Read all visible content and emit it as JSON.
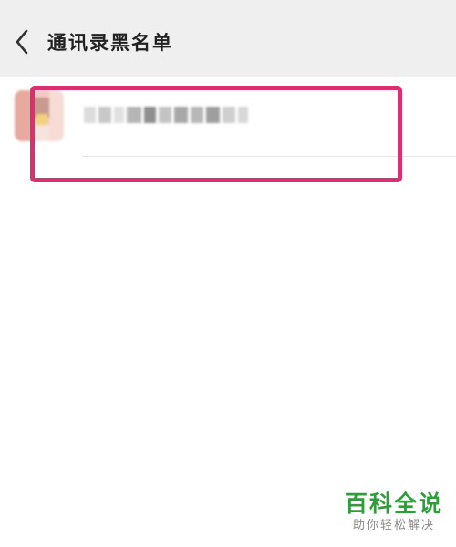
{
  "header": {
    "title": "通讯录黑名单",
    "back_icon": "chevron-left-icon"
  },
  "contact_list": {
    "items": [
      {
        "name": "",
        "avatar": "blurred-avatar"
      }
    ]
  },
  "colors": {
    "header_bg": "#efefef",
    "highlight": "#d9306f",
    "watermark_green": "#2e9d3a"
  },
  "watermark": {
    "title": "百科全说",
    "subtitle": "助你轻松解决"
  }
}
